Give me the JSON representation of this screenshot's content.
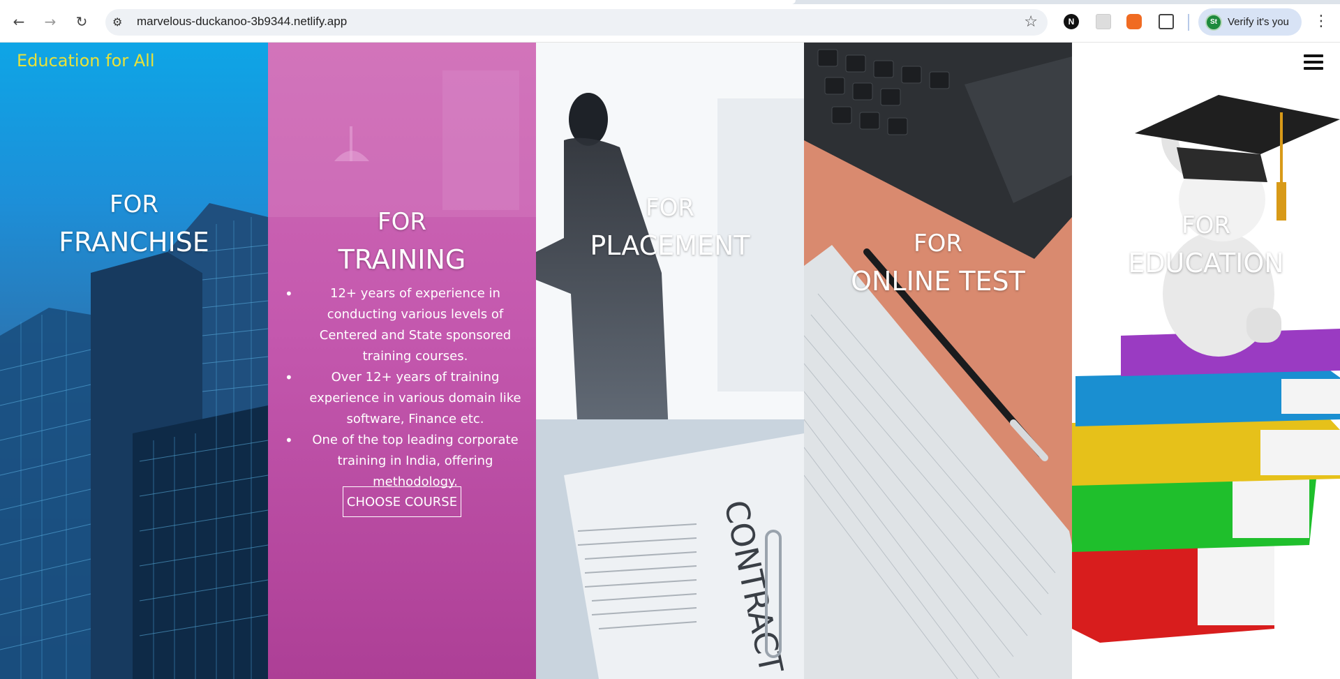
{
  "browser": {
    "url": "marvelous-duckanoo-3b9344.netlify.app",
    "profile_label": "Verify it's you",
    "profile_initials": "St",
    "ext_n_label": "N"
  },
  "site": {
    "brand": "Education for All"
  },
  "panels": [
    {
      "for": "FOR",
      "name": "FRANCHISE"
    },
    {
      "for": "FOR",
      "name": "TRAINING",
      "bullets": [
        "12+ years of experience in conducting various levels of Centered and State sponsored training courses.",
        "Over 12+ years of training experience in various domain like software, Finance etc.",
        "One of the top leading corporate training in India, offering methodology."
      ],
      "button": "CHOOSE COURSE"
    },
    {
      "for": "FOR",
      "name": "PLACEMENT"
    },
    {
      "for": "FOR",
      "name": "ONLINE TEST"
    },
    {
      "for": "FOR",
      "name": "EDUCATION"
    }
  ],
  "images": {
    "contract_word": "CONTRACT"
  }
}
